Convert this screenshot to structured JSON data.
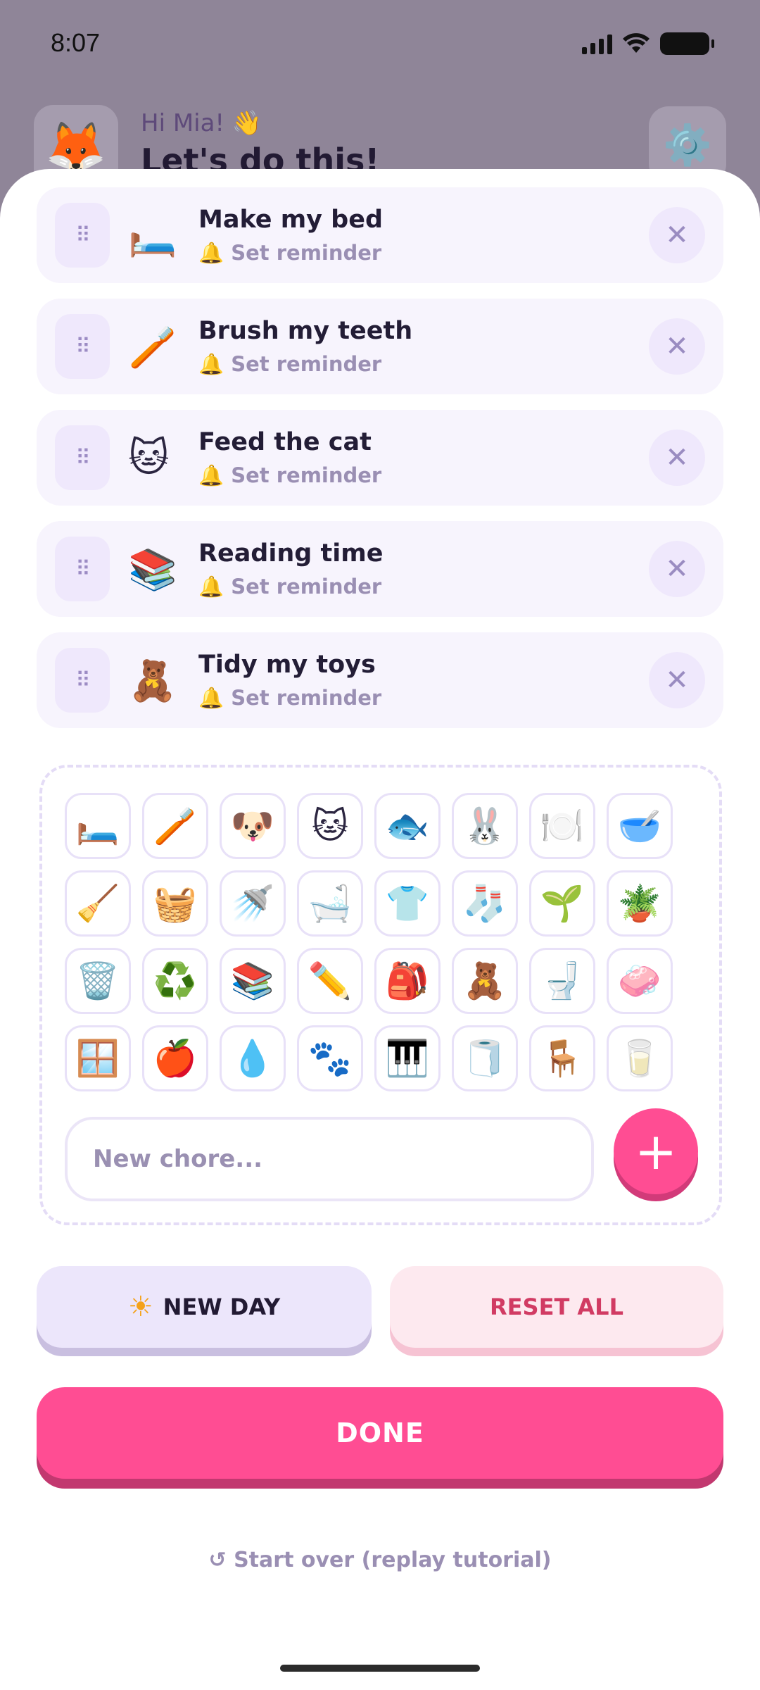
{
  "status_bar": {
    "time": "8:07"
  },
  "header": {
    "avatar_emoji": "🦊",
    "greeting": "Hi Mia! 👋",
    "headline": "Let's do this!",
    "settings_icon": "⚙️"
  },
  "chores": [
    {
      "emoji": "🛏️",
      "title": "Make my bed",
      "reminder": "🔔 Set reminder"
    },
    {
      "emoji": "🪥",
      "title": "Brush my teeth",
      "reminder": "🔔 Set reminder"
    },
    {
      "emoji": "🐱",
      "title": "Feed the cat",
      "reminder": "🔔 Set reminder"
    },
    {
      "emoji": "📚",
      "title": "Reading time",
      "reminder": "🔔 Set reminder"
    },
    {
      "emoji": "🧸",
      "title": "Tidy my toys",
      "reminder": "🔔 Set reminder"
    }
  ],
  "icons": {
    "drag_handle": "⠿",
    "remove": "✕",
    "add": "+",
    "sun": "☀",
    "replay": "↺"
  },
  "picker": {
    "emojis": [
      "🛏️",
      "🪥",
      "🐶",
      "🐱",
      "🐟",
      "🐰",
      "🍽️",
      "🥣",
      "🧹",
      "🧺",
      "🚿",
      "🛁",
      "👕",
      "🧦",
      "🌱",
      "🪴",
      "🗑️",
      "♻️",
      "📚",
      "✏️",
      "🎒",
      "🧸",
      "🚽",
      "🧼",
      "🪟",
      "🍎",
      "💧",
      "🐾",
      "🎹",
      "🧻",
      "🪑",
      "🥛"
    ],
    "input_placeholder": "New chore...",
    "input_value": ""
  },
  "actions": {
    "new_day_label": "NEW DAY",
    "reset_label": "RESET ALL",
    "done_label": "DONE",
    "start_over_label": "Start over (replay tutorial)"
  },
  "colors": {
    "accent_pink": "#ff4d93",
    "lavender": "#ece6fb",
    "reset_red": "#d13b63"
  }
}
